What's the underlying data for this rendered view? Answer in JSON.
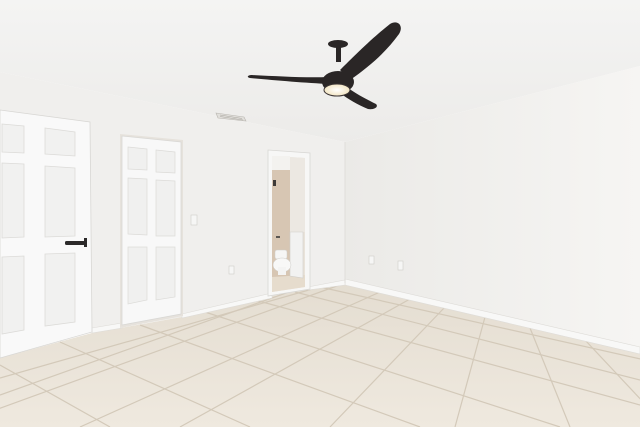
{
  "scene": {
    "description_label": "",
    "watermark_text": "",
    "colors": {
      "ceiling": "#f2f2f0",
      "wall_left": "#f1f0ee",
      "wall_back": "#eeedeb",
      "wall_right": "#f3f2f0",
      "floor_tile": "#ece6db",
      "grout": "#d6cdbf",
      "baseboard": "#f7f7f6",
      "door": "#f8f8f8",
      "door_panel": "#efefee",
      "fan_blade": "#2a2626",
      "fan_light": "#fff8e0",
      "bathroom_wall": "#d8c6b2",
      "door_handle": "#2c2a2a"
    }
  }
}
